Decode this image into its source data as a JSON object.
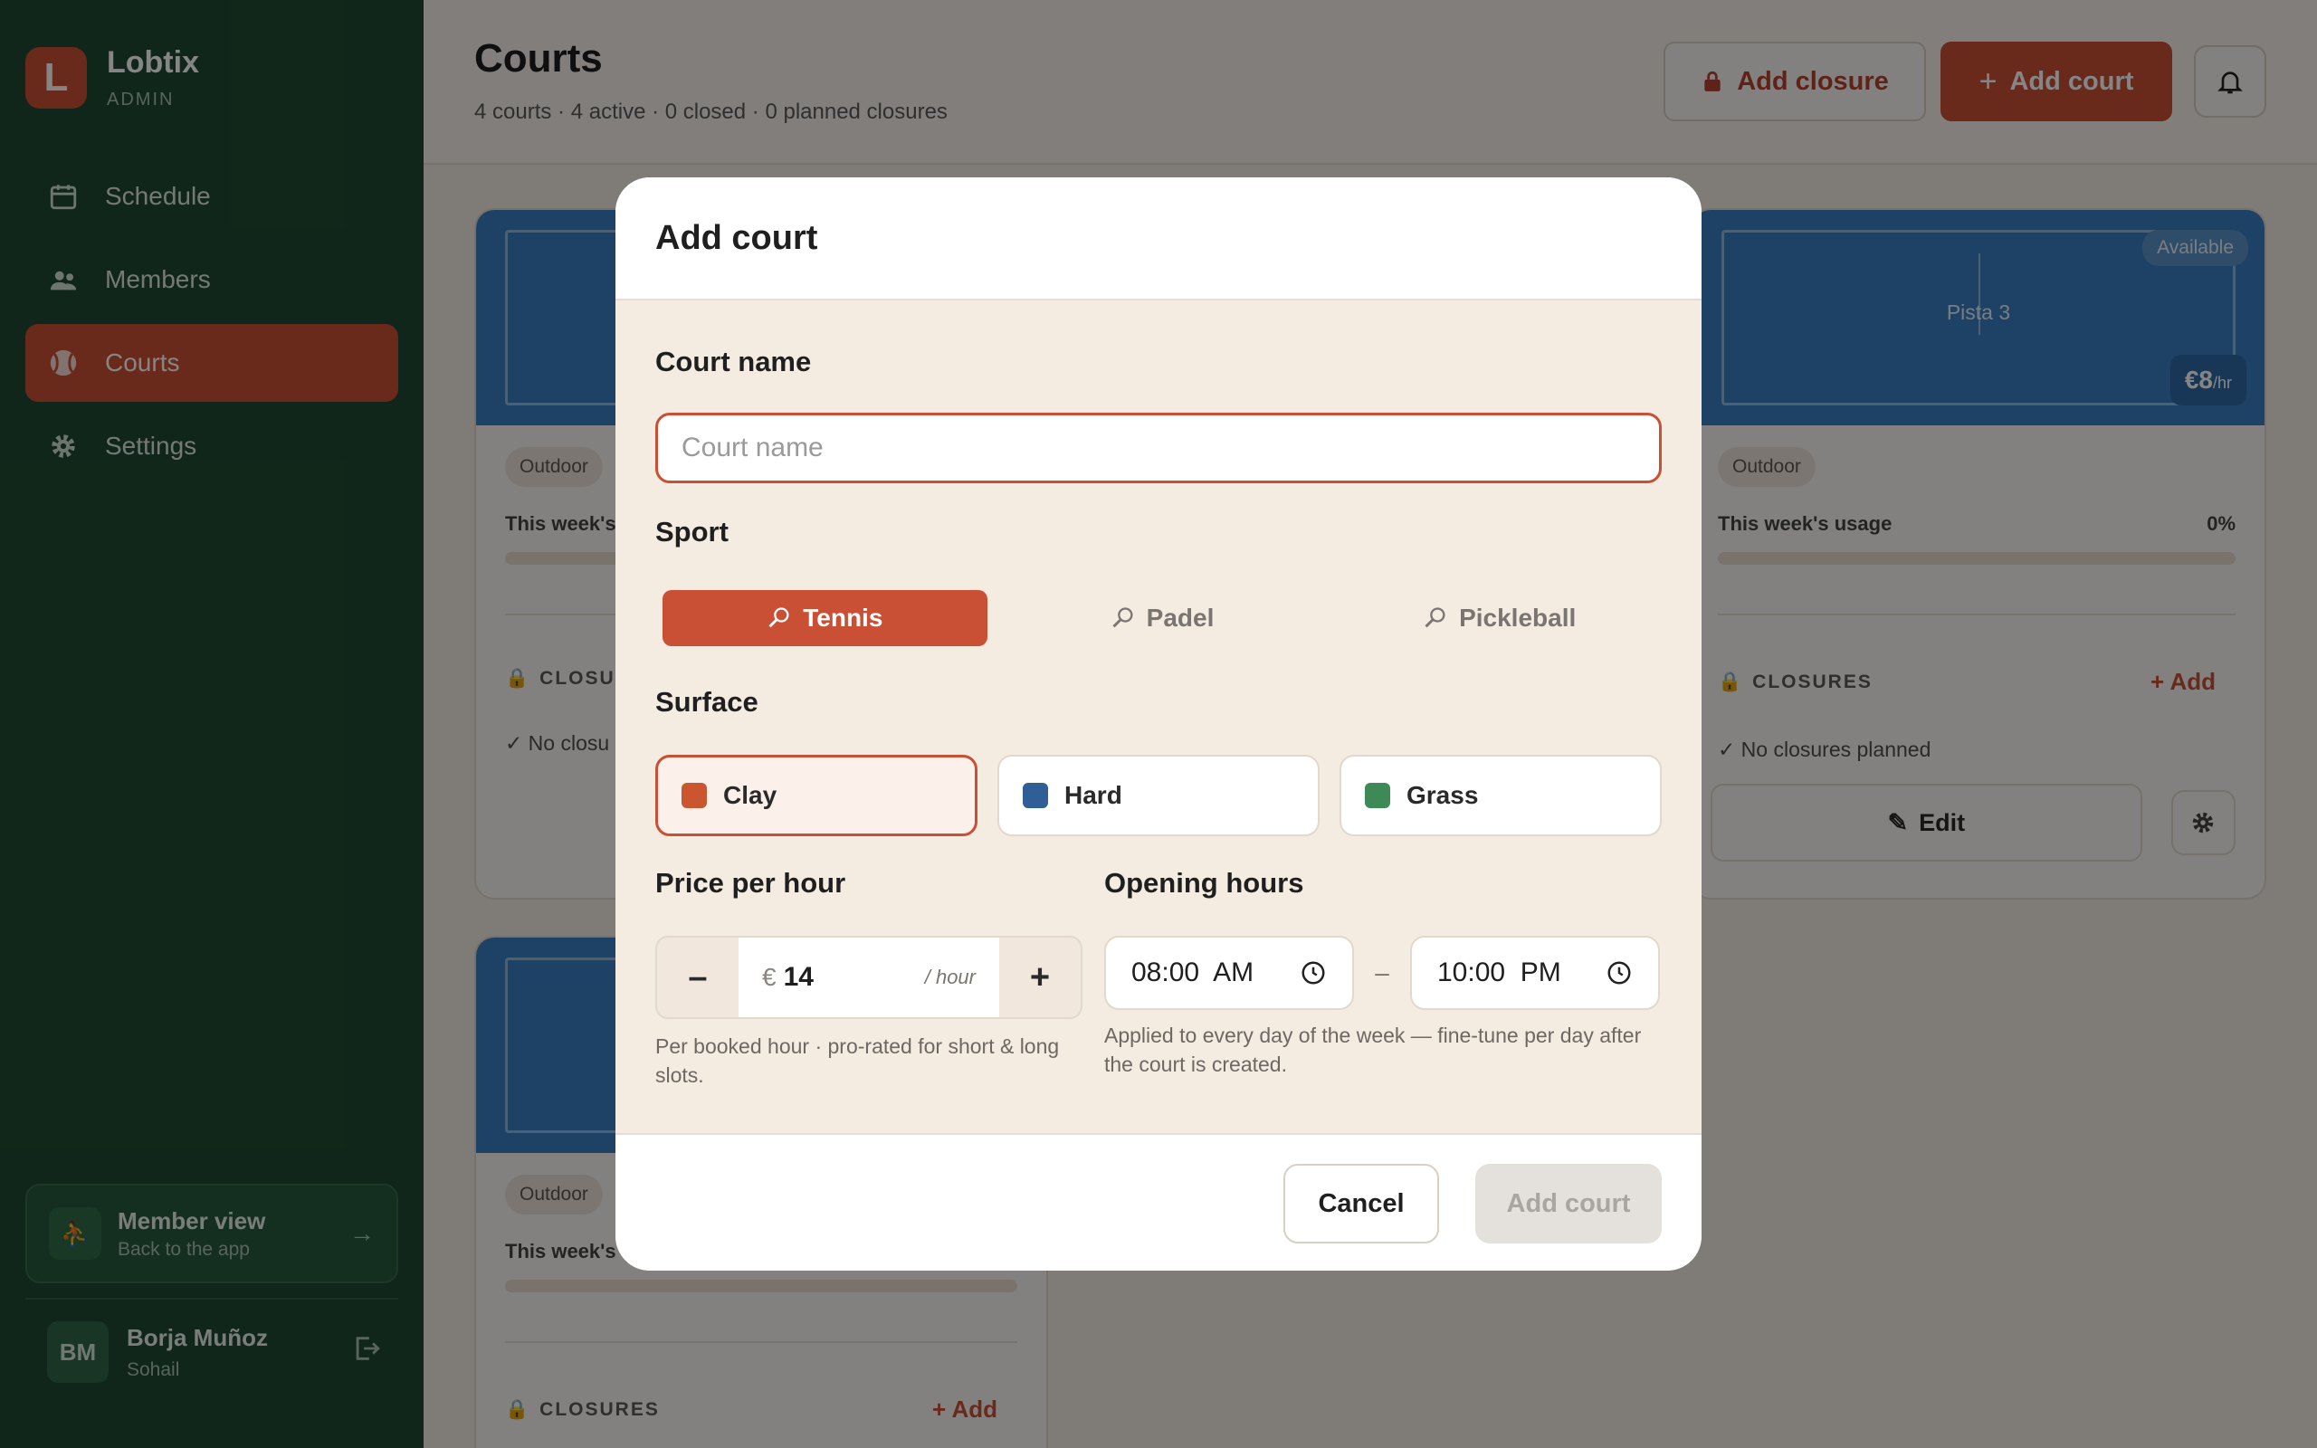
{
  "brand": {
    "logo_letter": "L",
    "name": "Lobtix",
    "role": "ADMIN"
  },
  "nav": [
    {
      "label": "Schedule",
      "icon": "calendar-icon"
    },
    {
      "label": "Members",
      "icon": "people-icon"
    },
    {
      "label": "Courts",
      "icon": "tennis-ball-icon",
      "active": true
    },
    {
      "label": "Settings",
      "icon": "gear-icon"
    }
  ],
  "member_view": {
    "title": "Member view",
    "subtitle": "Back to the app"
  },
  "user": {
    "initials": "BM",
    "name": "Borja Muñoz",
    "club": "Sohail"
  },
  "header": {
    "title": "Courts",
    "subtitle": "4 courts · 4 active · 0 closed · 0 planned closures",
    "add_closure": "Add closure",
    "add_court": "Add court"
  },
  "cards": {
    "left_top": {
      "tag": "Outdoor",
      "usage_label": "This week's",
      "closures": "CLOSUR",
      "no_closures": "No closu"
    },
    "right_top": {
      "status": "Available",
      "court_name": "Pista 3",
      "price": "€8",
      "price_unit": "/hr",
      "tag": "Outdoor",
      "usage_label": "This week's usage",
      "usage_value": "0%",
      "closures": "CLOSURES",
      "add": "Add",
      "no_closures": "No closures planned",
      "edit": "Edit"
    },
    "left_bottom": {
      "tag": "Outdoor",
      "usage_label": "This week's",
      "closures": "CLOSURES",
      "add": "Add"
    }
  },
  "modal": {
    "title": "Add court",
    "name_label": "Court name",
    "name_placeholder": "Court name",
    "sport_label": "Sport",
    "sports": [
      {
        "label": "Tennis",
        "selected": true
      },
      {
        "label": "Padel",
        "selected": false
      },
      {
        "label": "Pickleball",
        "selected": false
      }
    ],
    "surface_label": "Surface",
    "surfaces": [
      {
        "label": "Clay",
        "color": "#c9562f",
        "selected": true
      },
      {
        "label": "Hard",
        "color": "#2f5f96",
        "selected": false
      },
      {
        "label": "Grass",
        "color": "#3d8a56",
        "selected": false
      }
    ],
    "price_label": "Price per hour",
    "currency": "€",
    "price": "14",
    "per_hour": "/ hour",
    "price_help": "Per booked hour · pro-rated for short & long slots.",
    "hours_label": "Opening hours",
    "open_time": "08:00  AM",
    "close_time": "10:00  PM",
    "time_separator": "–",
    "hours_help": "Applied to every day of the week — fine-tune per day after the court is created.",
    "cancel": "Cancel",
    "submit": "Add court"
  }
}
